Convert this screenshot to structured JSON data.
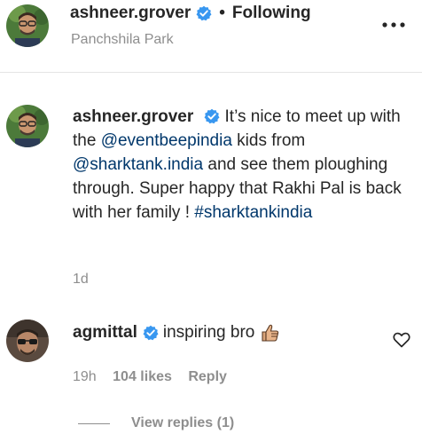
{
  "post": {
    "author": "ashneer.grover",
    "follow_status": "Following",
    "separator": "•",
    "location": "Panchshila Park",
    "more_icon": "more-horizontal-icon"
  },
  "caption": {
    "author": "ashneer.grover",
    "parts": {
      "t1": "It’s nice to meet up with the ",
      "mention1": "@eventbeepindia",
      "t2": " kids from ",
      "mention2": "@sharktank.india",
      "t3": " and see them ploughing through. Super happy that Rakhi Pal is back with her family ! ",
      "hashtag": "#sharktankindia"
    },
    "time": "1d"
  },
  "comment": {
    "author": "agmittal",
    "text": "inspiring bro",
    "emoji": "thumbs-up",
    "time": "19h",
    "likes": "104 likes",
    "reply_label": "Reply",
    "view_replies": "View replies (1)"
  },
  "colors": {
    "text": "#262626",
    "secondary": "#8e8e8e",
    "link": "#00376b",
    "verified": "#3897f0",
    "divider": "#e4e4e4"
  }
}
